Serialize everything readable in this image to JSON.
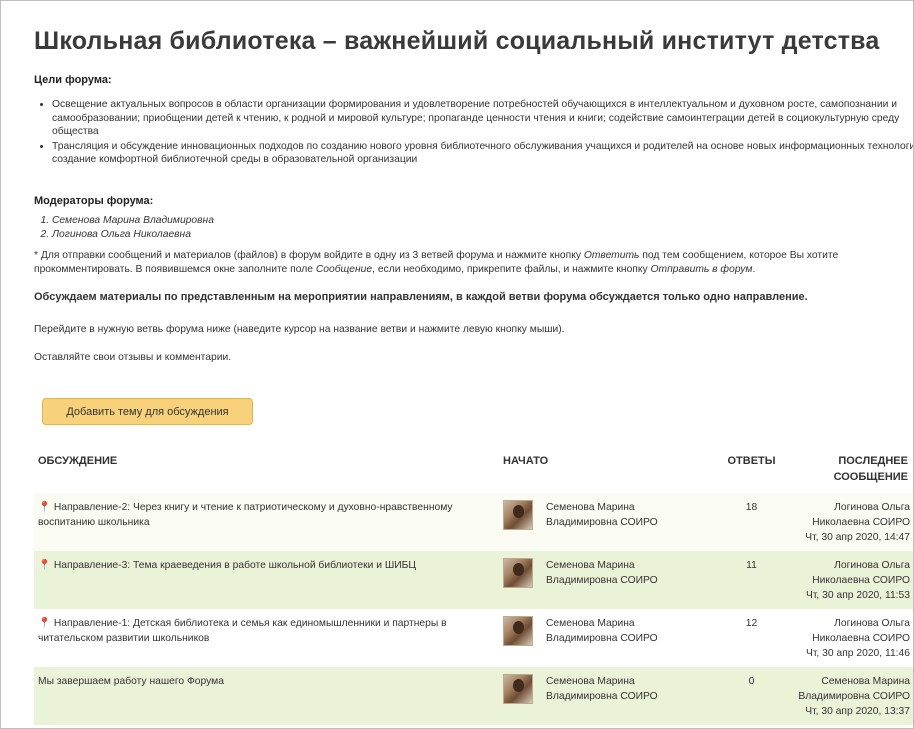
{
  "page": {
    "title": "Школьная библиотека – важнейший социальный институт детства",
    "goals_title": "Цели форума:",
    "goals": [
      "Освещение актуальных вопросов в области организации формирования и удовлетворение потребностей обучающихся в интеллектуальном и духовном росте, самопознании и самообразовании; приобщении детей к чтению, к родной и мировой культуре; пропаганде ценности чтения и книги; содействие самоинтеграции детей в социокультурную среду общества",
      "Трансляция и обсуждение инновационных подходов по созданию нового уровня библиотечного обслуживания учащихся и родителей на основе новых информационных технологий, создание комфортной библиотечной среды в образовательной организации"
    ],
    "moderators_title": "Модераторы форума:",
    "moderators": [
      "Семенова Марина Владимировна",
      "Логинова Ольга Николаевна"
    ],
    "note": {
      "part1": "* Для отправки сообщений и материалов (файлов) в форум войдите в одну из 3 ветвей форума и нажмите кнопку ",
      "reply": "Ответить",
      "part2": " под тем сообщением, которое Вы хотите прокомментировать. В появившемся окне заполните поле ",
      "message": "Сообщение",
      "part3": ", если необходимо, прикрепите файлы, и нажмите кнопку ",
      "send": "Отправить в форум",
      "part4": "."
    },
    "bold_line": "Обсуждаем материалы по представленным на мероприятии направлениям, в каждой ветви форума обсуждается только одно направление.",
    "instruction": "Перейдите в нужную ветвь форума ниже (наведите курсор на название ветви и нажмите левую кнопку мыши).",
    "feedback": "Оставляйте свои отзывы и комментарии.",
    "add_button": "Добавить тему для обсуждения"
  },
  "table": {
    "headers": {
      "discussion": "Обсуждение",
      "started": "Начато",
      "replies": "Ответы",
      "last_line1": "Последнее",
      "last_line2": "сообщение"
    },
    "rows": [
      {
        "title": "Направление-2: Через книгу и чтение к патриотическому и духовно-нравственному воспитанию школьника",
        "pinned": true,
        "starter_line1": "Семенова Марина",
        "starter_line2": "Владимировна СОИРО",
        "replies": "18",
        "last_line1": "Логинова Ольга",
        "last_line2": "Николаевна СОИРО",
        "last_date": "Чт, 30 апр 2020, 14:47"
      },
      {
        "title": "Направление-3: Тема краеведения в работе школьной библиотеки и ШИБЦ",
        "pinned": true,
        "starter_line1": "Семенова Марина",
        "starter_line2": "Владимировна СОИРО",
        "replies": "11",
        "last_line1": "Логинова Ольга",
        "last_line2": "Николаевна СОИРО",
        "last_date": "Чт, 30 апр 2020, 11:53"
      },
      {
        "title": "Направление-1: Детская библиотека и семья как единомышленники и партнеры в читательском развитии школьников",
        "pinned": true,
        "starter_line1": "Семенова Марина",
        "starter_line2": "Владимировна СОИРО",
        "replies": "12",
        "last_line1": "Логинова Ольга",
        "last_line2": "Николаевна СОИРО",
        "last_date": "Чт, 30 апр 2020, 11:46"
      },
      {
        "title": "Мы завершаем работу нашего Форума",
        "pinned": false,
        "starter_line1": "Семенова Марина",
        "starter_line2": "Владимировна СОИРО",
        "replies": "0",
        "last_line1": "Семенова Марина",
        "last_line2": "Владимировна СОИРО",
        "last_date": "Чт, 30 апр 2020, 13:37"
      }
    ]
  },
  "colors": {
    "button_bg": "#f7d27a",
    "row_highlight": "#eaf3d8"
  }
}
